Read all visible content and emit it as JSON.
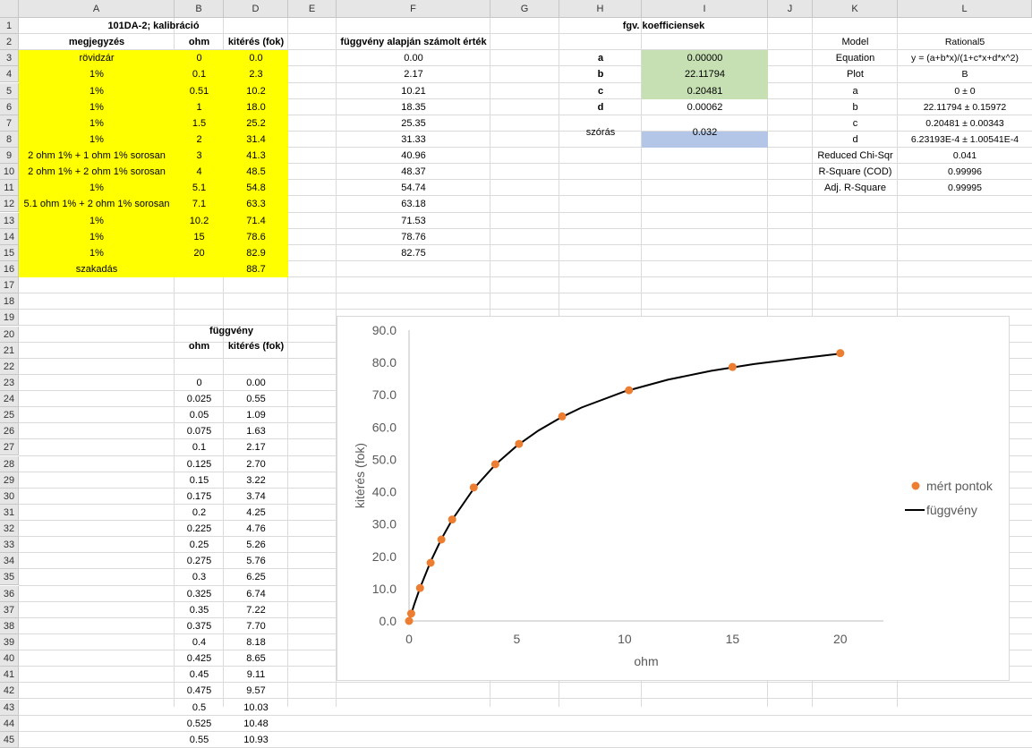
{
  "columns": [
    "A",
    "B",
    "D",
    "E",
    "F",
    "G",
    "H",
    "I",
    "J",
    "K",
    "L"
  ],
  "rows": [
    "1",
    "2",
    "3",
    "4",
    "5",
    "6",
    "7",
    "8",
    "9",
    "10",
    "11",
    "12",
    "13",
    "14",
    "15",
    "16",
    "17",
    "18",
    "19",
    "20",
    "21",
    "22",
    "23",
    "24",
    "25",
    "26",
    "27",
    "28",
    "29",
    "30",
    "31",
    "32",
    "33",
    "34",
    "35",
    "36",
    "37",
    "38",
    "39",
    "40",
    "41",
    "42",
    "43",
    "44",
    "45"
  ],
  "calibration": {
    "title": "101DA-2; kalibráció",
    "headers": [
      "megjegyzés",
      "ohm",
      "kitérés (fok)"
    ],
    "rows": [
      {
        "note": "rövidzár",
        "ohm": "0",
        "deg": "0.0"
      },
      {
        "note": "1%",
        "ohm": "0.1",
        "deg": "2.3"
      },
      {
        "note": "1%",
        "ohm": "0.51",
        "deg": "10.2"
      },
      {
        "note": "1%",
        "ohm": "1",
        "deg": "18.0"
      },
      {
        "note": "1%",
        "ohm": "1.5",
        "deg": "25.2"
      },
      {
        "note": "1%",
        "ohm": "2",
        "deg": "31.4"
      },
      {
        "note": "2 ohm 1% + 1 ohm 1% sorosan",
        "ohm": "3",
        "deg": "41.3"
      },
      {
        "note": "2 ohm 1% + 2 ohm 1% sorosan",
        "ohm": "4",
        "deg": "48.5"
      },
      {
        "note": "1%",
        "ohm": "5.1",
        "deg": "54.8"
      },
      {
        "note": "5.1 ohm 1% + 2 ohm 1% sorosan",
        "ohm": "7.1",
        "deg": "63.3"
      },
      {
        "note": "1%",
        "ohm": "10.2",
        "deg": "71.4"
      },
      {
        "note": "1%",
        "ohm": "15",
        "deg": "78.6"
      },
      {
        "note": "1%",
        "ohm": "20",
        "deg": "82.9"
      },
      {
        "note": "szakadás",
        "ohm": "",
        "deg": "88.7"
      }
    ],
    "highlight_color": "#ffff00"
  },
  "computed": {
    "header": "függvény alapján számolt érték",
    "values": [
      "0.00",
      "2.17",
      "10.21",
      "18.35",
      "25.35",
      "31.33",
      "40.96",
      "48.37",
      "54.74",
      "63.18",
      "71.53",
      "78.76",
      "82.75"
    ]
  },
  "coefficients": {
    "header": "fgv. koefficiensek",
    "items": [
      {
        "name": "a",
        "value": "0.00000"
      },
      {
        "name": "b",
        "value": "22.11794"
      },
      {
        "name": "c",
        "value": "0.20481"
      },
      {
        "name": "d",
        "value": "0.00062"
      }
    ],
    "std_label": "szórás",
    "std_value": "0.032",
    "green_color": "#c6e0b4",
    "blue_color": "#b4c6e7"
  },
  "fit_report": [
    {
      "k": "Model",
      "v": "Rational5"
    },
    {
      "k": "Equation",
      "v": "y = (a+b*x)/(1+c*x+d*x^2)"
    },
    {
      "k": "Plot",
      "v": "B"
    },
    {
      "k": "a",
      "v": "0 ± 0"
    },
    {
      "k": "b",
      "v": "22.11794 ± 0.15972"
    },
    {
      "k": "c",
      "v": "0.20481 ± 0.00343"
    },
    {
      "k": "d",
      "v": "6.23193E-4 ± 1.00541E-4"
    },
    {
      "k": "Reduced Chi-Sqr",
      "v": "0.041"
    },
    {
      "k": "R-Square (COD)",
      "v": "0.99996"
    },
    {
      "k": "Adj. R-Square",
      "v": "0.99995"
    }
  ],
  "function_table": {
    "title": "függvény",
    "headers": [
      "ohm",
      "kitérés (fok)"
    ],
    "rows": [
      [
        "0",
        "0.00"
      ],
      [
        "0.025",
        "0.55"
      ],
      [
        "0.05",
        "1.09"
      ],
      [
        "0.075",
        "1.63"
      ],
      [
        "0.1",
        "2.17"
      ],
      [
        "0.125",
        "2.70"
      ],
      [
        "0.15",
        "3.22"
      ],
      [
        "0.175",
        "3.74"
      ],
      [
        "0.2",
        "4.25"
      ],
      [
        "0.225",
        "4.76"
      ],
      [
        "0.25",
        "5.26"
      ],
      [
        "0.275",
        "5.76"
      ],
      [
        "0.3",
        "6.25"
      ],
      [
        "0.325",
        "6.74"
      ],
      [
        "0.35",
        "7.22"
      ],
      [
        "0.375",
        "7.70"
      ],
      [
        "0.4",
        "8.18"
      ],
      [
        "0.425",
        "8.65"
      ],
      [
        "0.45",
        "9.11"
      ],
      [
        "0.475",
        "9.57"
      ],
      [
        "0.5",
        "10.03"
      ],
      [
        "0.525",
        "10.48"
      ],
      [
        "0.55",
        "10.93"
      ]
    ]
  },
  "chart_data": {
    "type": "scatter",
    "xlabel": "ohm",
    "ylabel": "kitérés (fok)",
    "xlim": [
      0,
      22
    ],
    "ylim": [
      0,
      90
    ],
    "xticks": [
      "0",
      "5",
      "10",
      "15",
      "20"
    ],
    "yticks": [
      "0.0",
      "10.0",
      "20.0",
      "30.0",
      "40.0",
      "50.0",
      "60.0",
      "70.0",
      "80.0",
      "90.0"
    ],
    "grid": false,
    "legend": "right",
    "series": [
      {
        "name": "mért pontok",
        "kind": "points",
        "color": "#ed7d31",
        "x": [
          0,
          0.1,
          0.51,
          1,
          1.5,
          2,
          3,
          4,
          5.1,
          7.1,
          10.2,
          15,
          20
        ],
        "y": [
          0.0,
          2.3,
          10.2,
          18.0,
          25.2,
          31.4,
          41.3,
          48.5,
          54.8,
          63.3,
          71.4,
          78.6,
          82.9
        ]
      },
      {
        "name": "függvény",
        "kind": "line",
        "color": "#000000",
        "x": [
          0,
          0.25,
          0.5,
          1,
          1.5,
          2,
          3,
          4,
          5,
          6,
          7,
          8,
          10,
          12,
          14,
          16,
          18,
          20
        ],
        "y": [
          0,
          5.26,
          10.03,
          18.35,
          25.35,
          31.33,
          40.96,
          48.37,
          54.22,
          58.92,
          62.81,
          66.06,
          71.03,
          74.66,
          77.4,
          79.5,
          81.16,
          82.75
        ]
      }
    ]
  }
}
